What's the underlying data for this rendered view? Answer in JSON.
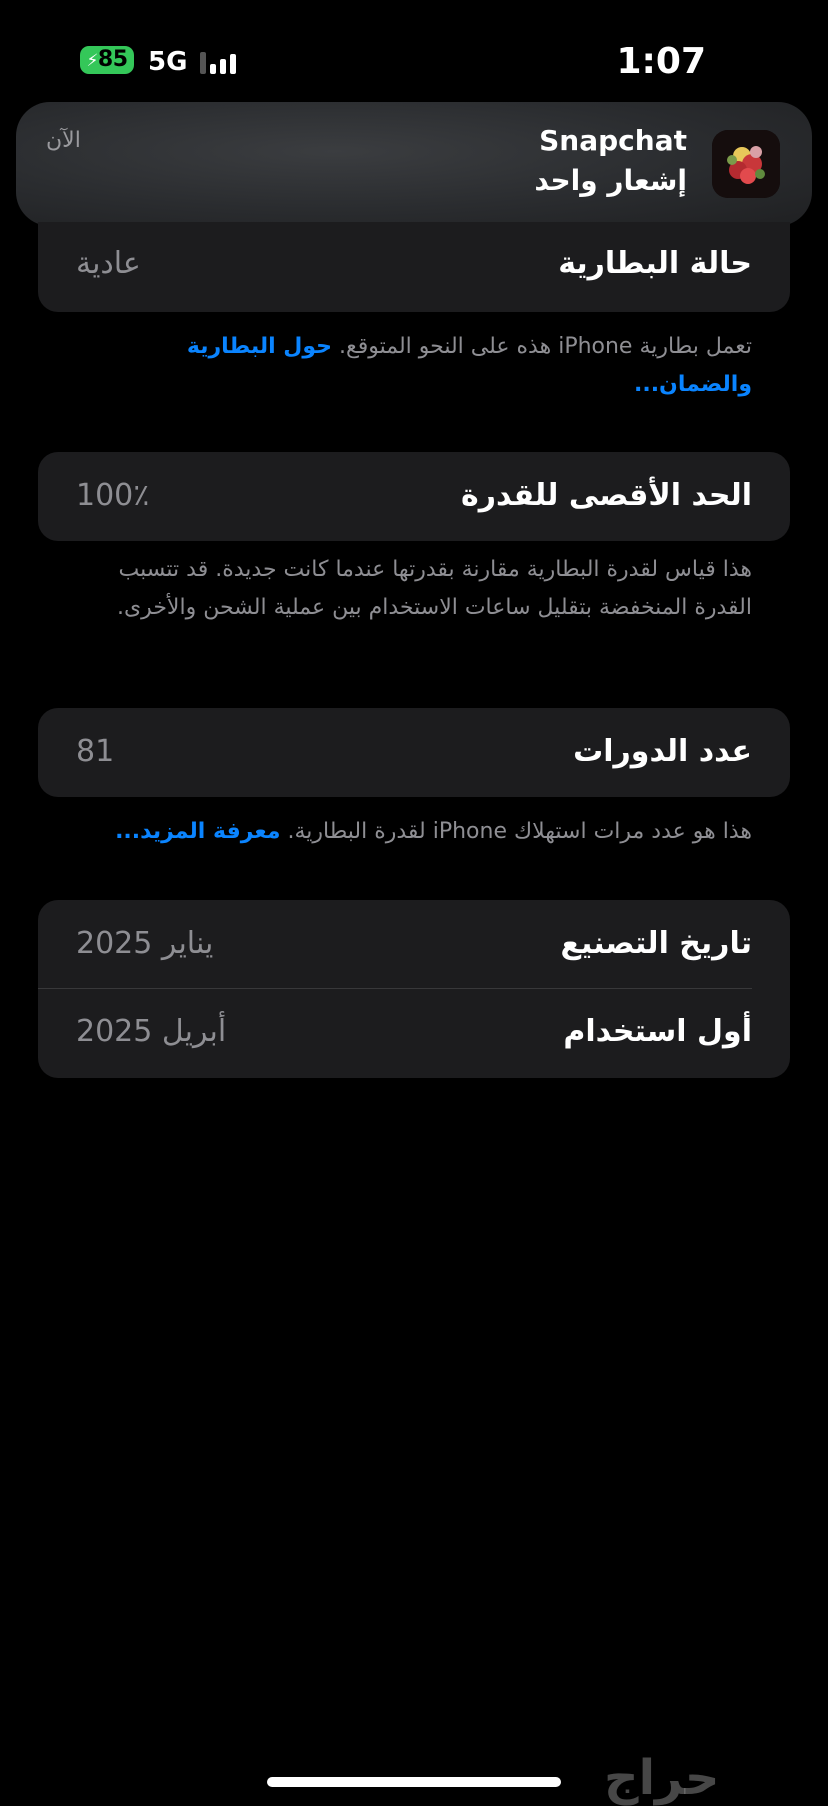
{
  "status_bar": {
    "battery_level": "85",
    "network": "5G",
    "time": "1:07"
  },
  "notification": {
    "app_name": "Snapchat",
    "message": "إشعار واحد",
    "time": "الآن"
  },
  "battery_health": {
    "label": "حالة البطارية",
    "value": "عادية",
    "note_text": "تعمل بطارية iPhone هذه على النحو المتوقع. ",
    "note_link": "حول البطارية والضمان..."
  },
  "maximum_capacity": {
    "label": "الحد الأقصى للقدرة",
    "value": "100٪",
    "note_text": "هذا قياس لقدرة البطارية مقارنة بقدرتها عندما كانت جديدة. قد تتسبب القدرة المنخفضة بتقليل ساعات الاستخدام بين عملية الشحن والأخرى."
  },
  "cycle_count": {
    "label": "عدد الدورات",
    "value": "81",
    "note_text": "هذا هو عدد مرات استهلاك iPhone لقدرة البطارية. ",
    "note_link": "معرفة المزيد..."
  },
  "dates": {
    "manufacture_label": "تاريخ التصنيع",
    "manufacture_value": "يناير 2025",
    "first_use_label": "أول استخدام",
    "first_use_value": "أبريل 2025"
  },
  "watermark": "حراج",
  "colors": {
    "background": "#000000",
    "card": "#1c1c1e",
    "link": "#0a84ff",
    "battery_green": "#34c759",
    "secondary_text": "#8e8e93"
  }
}
